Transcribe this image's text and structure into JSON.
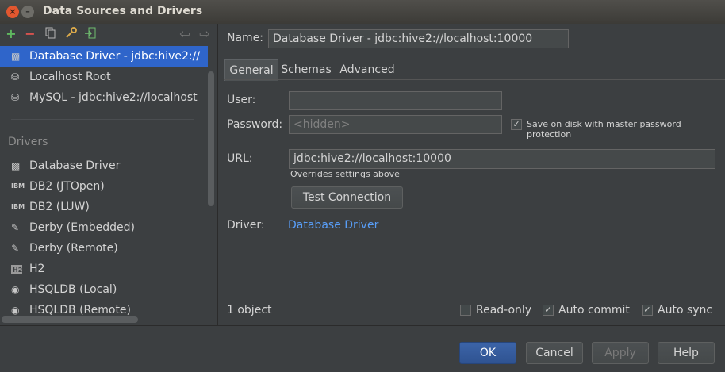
{
  "window": {
    "title": "Data Sources and Drivers",
    "close_glyph": "×",
    "min_glyph": "–"
  },
  "toolbar": {
    "add": "+",
    "remove": "−",
    "back": "⇦",
    "forward": "⇨"
  },
  "data_sources": [
    {
      "label": "Database Driver - jdbc:hive2://",
      "selected": true
    },
    {
      "label": "Localhost Root",
      "selected": false
    },
    {
      "label": "MySQL - jdbc:hive2://localhost",
      "selected": false
    }
  ],
  "drivers": {
    "header": "Drivers",
    "items": [
      {
        "label": "Database Driver",
        "icon": "database-driver-icon"
      },
      {
        "label": "DB2 (JTOpen)",
        "icon": "ibm-icon"
      },
      {
        "label": "DB2 (LUW)",
        "icon": "ibm-icon"
      },
      {
        "label": "Derby (Embedded)",
        "icon": "derby-icon"
      },
      {
        "label": "Derby (Remote)",
        "icon": "derby-icon"
      },
      {
        "label": "H2",
        "icon": "h2-icon"
      },
      {
        "label": "HSQLDB (Local)",
        "icon": "hsqldb-icon"
      },
      {
        "label": "HSQLDB (Remote)",
        "icon": "hsqldb-icon"
      }
    ]
  },
  "detail": {
    "name_label": "Name:",
    "name_value": "Database Driver - jdbc:hive2://localhost:10000",
    "tabs": [
      "General",
      "Schemas",
      "Advanced"
    ],
    "user_label": "User:",
    "user_value": "",
    "password_label": "Password:",
    "password_placeholder": "<hidden>",
    "save_on_disk": "Save on disk with master password protection",
    "url_label": "URL:",
    "url_value": "jdbc:hive2://localhost:10000",
    "url_note": "Overrides settings above",
    "test_connection": "Test Connection",
    "driver_label": "Driver:",
    "driver_link": "Database Driver"
  },
  "status": {
    "count": "1 object",
    "read_only": "Read-only",
    "auto_commit": "Auto commit",
    "auto_sync": "Auto sync"
  },
  "buttons": {
    "ok": "OK",
    "cancel": "Cancel",
    "apply": "Apply",
    "help": "Help"
  }
}
